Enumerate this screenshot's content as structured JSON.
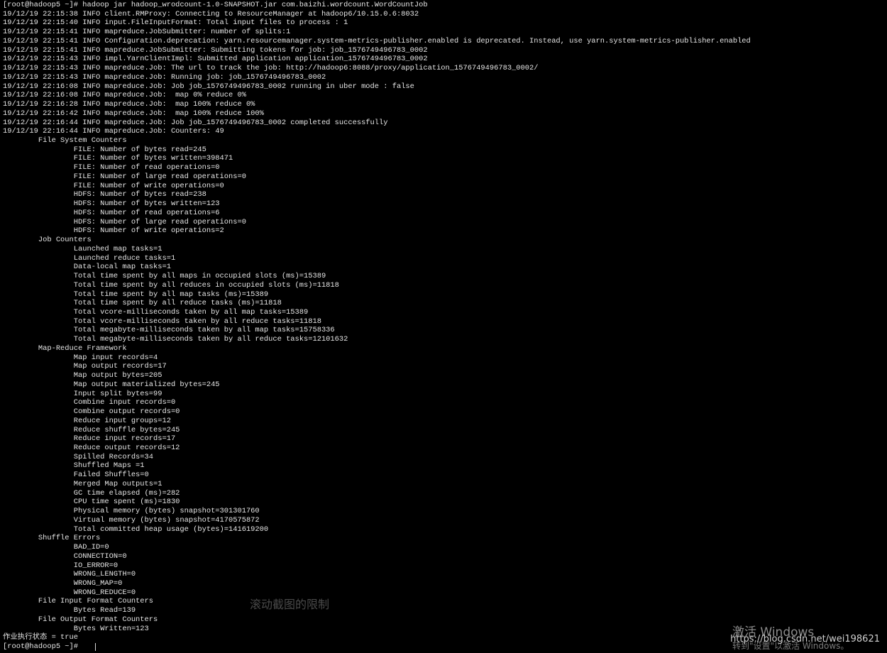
{
  "terminal": {
    "lines": [
      "[root@hadoop5 ~]# hadoop jar hadoop_wrodcount-1.0-SNAPSHOT.jar com.baizhi.wordcount.WordCountJob",
      "19/12/19 22:15:38 INFO client.RMProxy: Connecting to ResourceManager at hadoop6/10.15.0.6:8032",
      "19/12/19 22:15:40 INFO input.FileInputFormat: Total input files to process : 1",
      "19/12/19 22:15:41 INFO mapreduce.JobSubmitter: number of splits:1",
      "19/12/19 22:15:41 INFO Configuration.deprecation: yarn.resourcemanager.system-metrics-publisher.enabled is deprecated. Instead, use yarn.system-metrics-publisher.enabled",
      "19/12/19 22:15:41 INFO mapreduce.JobSubmitter: Submitting tokens for job: job_1576749496783_0002",
      "19/12/19 22:15:43 INFO impl.YarnClientImpl: Submitted application application_1576749496783_0002",
      "19/12/19 22:15:43 INFO mapreduce.Job: The url to track the job: http://hadoop6:8088/proxy/application_1576749496783_0002/",
      "19/12/19 22:15:43 INFO mapreduce.Job: Running job: job_1576749496783_0002",
      "19/12/19 22:16:08 INFO mapreduce.Job: Job job_1576749496783_0002 running in uber mode : false",
      "19/12/19 22:16:08 INFO mapreduce.Job:  map 0% reduce 0%",
      "19/12/19 22:16:28 INFO mapreduce.Job:  map 100% reduce 0%",
      "19/12/19 22:16:42 INFO mapreduce.Job:  map 100% reduce 100%",
      "19/12/19 22:16:44 INFO mapreduce.Job: Job job_1576749496783_0002 completed successfully",
      "19/12/19 22:16:44 INFO mapreduce.Job: Counters: 49",
      "        File System Counters",
      "                FILE: Number of bytes read=245",
      "                FILE: Number of bytes written=398471",
      "                FILE: Number of read operations=0",
      "                FILE: Number of large read operations=0",
      "                FILE: Number of write operations=0",
      "                HDFS: Number of bytes read=238",
      "                HDFS: Number of bytes written=123",
      "                HDFS: Number of read operations=6",
      "                HDFS: Number of large read operations=0",
      "                HDFS: Number of write operations=2",
      "        Job Counters",
      "                Launched map tasks=1",
      "                Launched reduce tasks=1",
      "                Data-local map tasks=1",
      "                Total time spent by all maps in occupied slots (ms)=15389",
      "                Total time spent by all reduces in occupied slots (ms)=11818",
      "                Total time spent by all map tasks (ms)=15389",
      "                Total time spent by all reduce tasks (ms)=11818",
      "                Total vcore-milliseconds taken by all map tasks=15389",
      "                Total vcore-milliseconds taken by all reduce tasks=11818",
      "                Total megabyte-milliseconds taken by all map tasks=15758336",
      "                Total megabyte-milliseconds taken by all reduce tasks=12101632",
      "        Map-Reduce Framework",
      "                Map input records=4",
      "                Map output records=17",
      "                Map output bytes=205",
      "                Map output materialized bytes=245",
      "                Input split bytes=99",
      "                Combine input records=0",
      "                Combine output records=0",
      "                Reduce input groups=12",
      "                Reduce shuffle bytes=245",
      "                Reduce input records=17",
      "                Reduce output records=12",
      "                Spilled Records=34",
      "                Shuffled Maps =1",
      "                Failed Shuffles=0",
      "                Merged Map outputs=1",
      "                GC time elapsed (ms)=282",
      "                CPU time spent (ms)=1830",
      "                Physical memory (bytes) snapshot=301301760",
      "                Virtual memory (bytes) snapshot=4170575872",
      "                Total committed heap usage (bytes)=141619200",
      "        Shuffle Errors",
      "                BAD_ID=0",
      "                CONNECTION=0",
      "                IO_ERROR=0",
      "                WRONG_LENGTH=0",
      "                WRONG_MAP=0",
      "                WRONG_REDUCE=0",
      "        File Input Format Counters",
      "                Bytes Read=139",
      "        File Output Format Counters",
      "                Bytes Written=123",
      "作业执行状态 = true",
      "[root@hadoop5 ~]# "
    ]
  },
  "overlays": {
    "ghost_title": "滚动截图的限制",
    "activate_title": "激活 Windows",
    "activate_sub": "转到\"设置\"以激活 Windows。",
    "blog_url": "https://blog.csdn.net/wei198621"
  }
}
